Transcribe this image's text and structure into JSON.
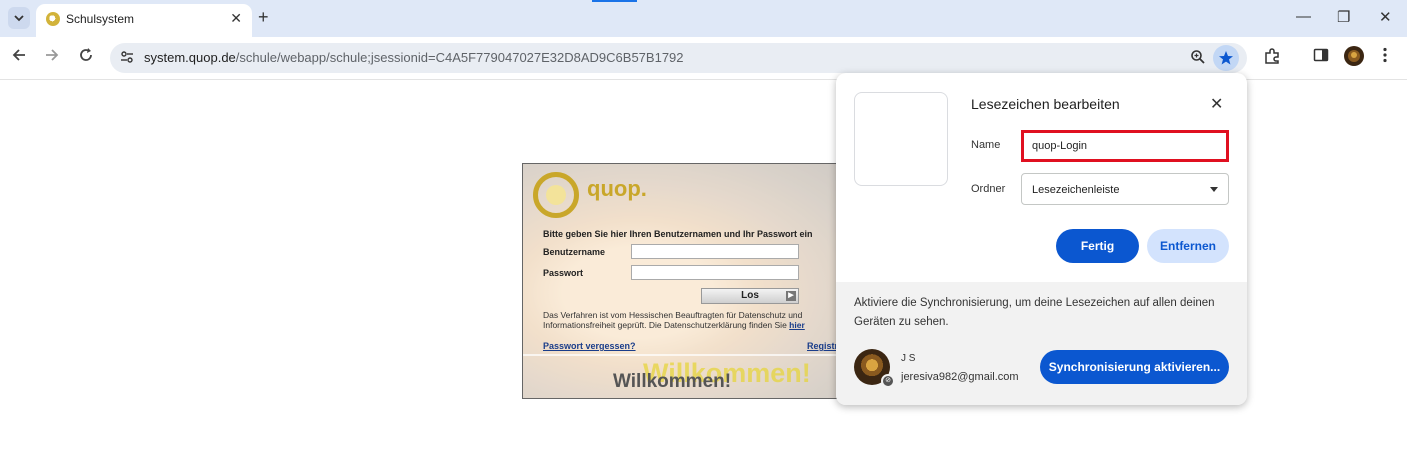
{
  "browser": {
    "tab": {
      "title": "Schulsystem",
      "close": "✕"
    },
    "new_tab": "+",
    "window_controls": {
      "minimize": "—",
      "maximize": "❐",
      "close": "✕"
    },
    "url": {
      "host": "system.quop.de",
      "path": "/schule/webapp/schule;jsessionid=C4A5F779047027E32D8AD9C6B57B1792"
    },
    "accent_color": "#1a73e8",
    "icons": [
      "tab-search-icon",
      "back-icon",
      "forward-icon",
      "reload-icon",
      "site-info-icon",
      "zoom-icon",
      "star-icon",
      "extensions-icon",
      "side-panel-icon",
      "profile-avatar-icon",
      "menu-icon"
    ]
  },
  "login": {
    "logo_text": "quop.",
    "intro": "Bitte geben Sie hier Ihren Benutzernamen und Ihr Passwort ein",
    "username_label": "Benutzername",
    "password_label": "Passwort",
    "submit_label": "Los",
    "notice_text": "Das Verfahren ist vom Hessischen Beauftragten für Datenschutz und Informationsfreiheit geprüft. Die Datenschutzerklärung finden Sie ",
    "notice_link": "hier",
    "forgot_password": "Passwort vergessen?",
    "register": "Registrieren",
    "welcome_shadow": "Willkommen!",
    "welcome": "Willkommen!"
  },
  "bookmark_popup": {
    "title": "Lesezeichen bearbeiten",
    "close": "✕",
    "name_label": "Name",
    "name_value": "quop-Login",
    "folder_label": "Ordner",
    "folder_value": "Lesezeichenleiste",
    "done_label": "Fertig",
    "remove_label": "Entfernen",
    "sync_text": "Aktiviere die Synchronisierung, um deine Lesezeichen auf allen deinen Geräten zu sehen.",
    "account_name": "J S",
    "account_email": "jeresiva982@gmail.com",
    "sync_button": "Synchronisierung aktivieren...",
    "highlight_color": "#e01020",
    "primary_color": "#0b57d0"
  }
}
